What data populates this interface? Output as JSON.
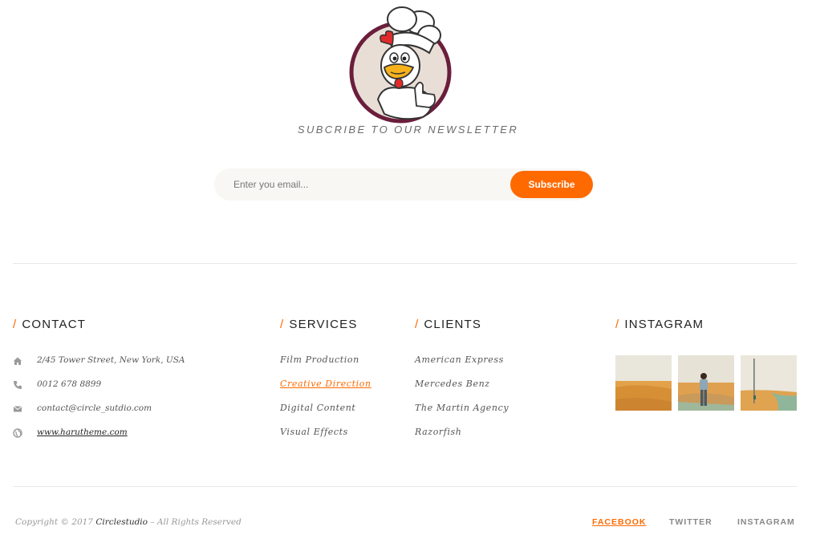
{
  "colors": {
    "accent": "#ff6a00",
    "text": "#333333",
    "muted": "#999999",
    "input_bg": "#f8f7f4"
  },
  "newsletter": {
    "title": "SUBCRIBE TO OUR NEWSLETTER",
    "email_placeholder": "Enter you email...",
    "subscribe_label": "Subscribe"
  },
  "contact": {
    "heading": "CONTACT",
    "items": [
      {
        "icon": "home-icon",
        "text": "2/45 Tower Street, New York, USA"
      },
      {
        "icon": "phone-icon",
        "text": "0012 678 8899"
      },
      {
        "icon": "mail-icon",
        "text": "contact@circle_sutdio.com"
      },
      {
        "icon": "globe-icon",
        "text": "www.harutheme.com"
      }
    ]
  },
  "services": {
    "heading": "SERVICES",
    "items": [
      "Film Production",
      "Creative Direction",
      "Digital Content",
      "Visual Effects"
    ],
    "active_index": 1
  },
  "clients": {
    "heading": "CLIENTS",
    "items": [
      "American Express",
      "Mercedes Benz",
      "The Martin Agency",
      "Razorfish"
    ]
  },
  "instagram": {
    "heading": "INSTAGRAM",
    "photos": [
      "desert-photo",
      "person-in-desert-photo",
      "desert-road-photo"
    ]
  },
  "footer": {
    "copyright_prefix": "Copyright © 2017",
    "brand": "Circlestudio",
    "copyright_suffix": "– All Rights Reserved",
    "social": [
      "FACEBOOK",
      "TWITTER",
      "INSTAGRAM"
    ],
    "social_active_index": 0
  }
}
